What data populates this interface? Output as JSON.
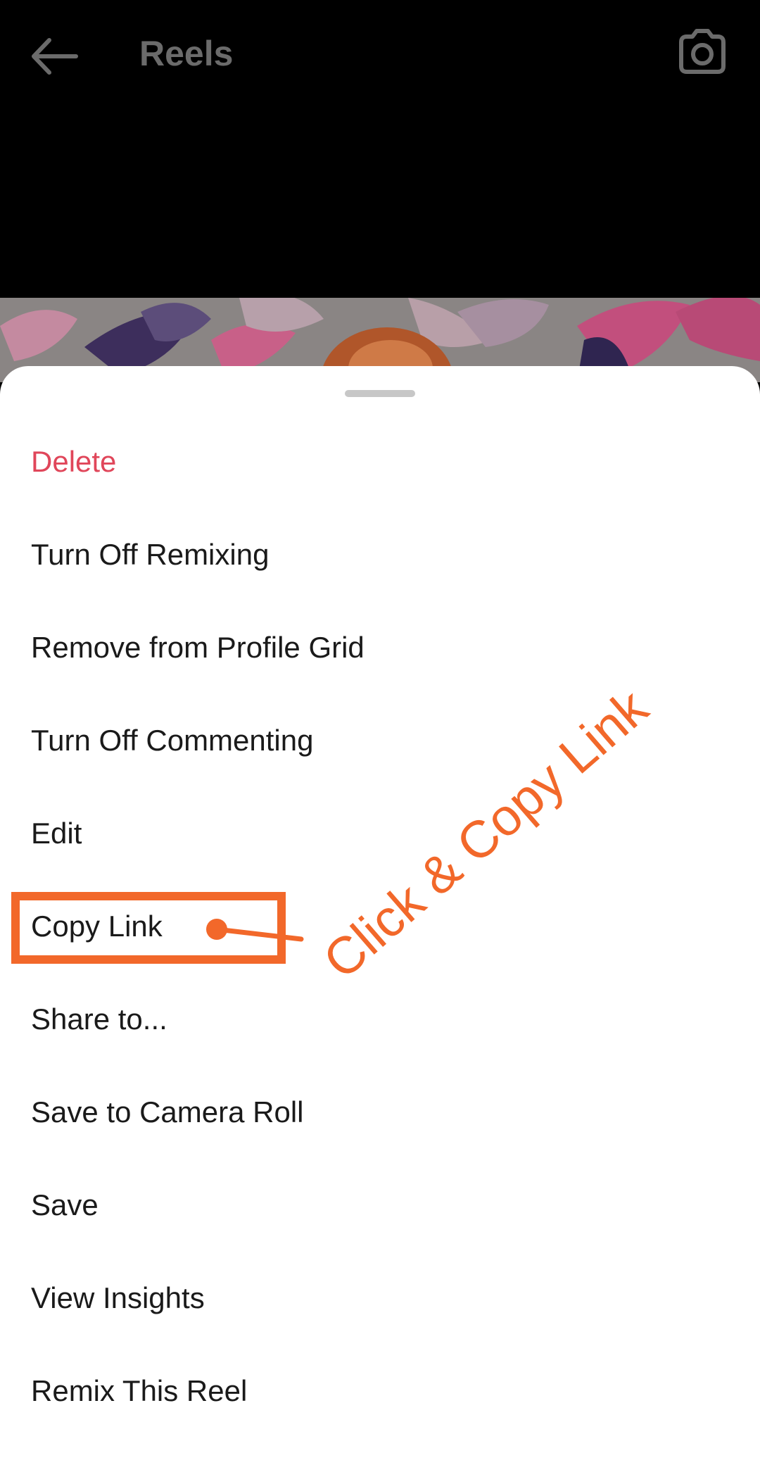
{
  "header": {
    "title": "Reels",
    "back_icon": "back-arrow-icon",
    "camera_icon": "camera-icon"
  },
  "menu": {
    "items": [
      {
        "label": "Delete",
        "danger": true
      },
      {
        "label": "Turn Off Remixing"
      },
      {
        "label": "Remove from Profile Grid"
      },
      {
        "label": "Turn Off Commenting"
      },
      {
        "label": "Edit"
      },
      {
        "label": "Copy Link"
      },
      {
        "label": "Share to..."
      },
      {
        "label": "Save to Camera Roll"
      },
      {
        "label": "Save"
      },
      {
        "label": "View Insights"
      },
      {
        "label": "Remix This Reel"
      }
    ]
  },
  "annotation": {
    "text": "Click & Copy Link",
    "color": "#f2682a"
  },
  "colors": {
    "danger": "#e0465a",
    "header_bg": "#000000",
    "sheet_bg": "#ffffff"
  }
}
